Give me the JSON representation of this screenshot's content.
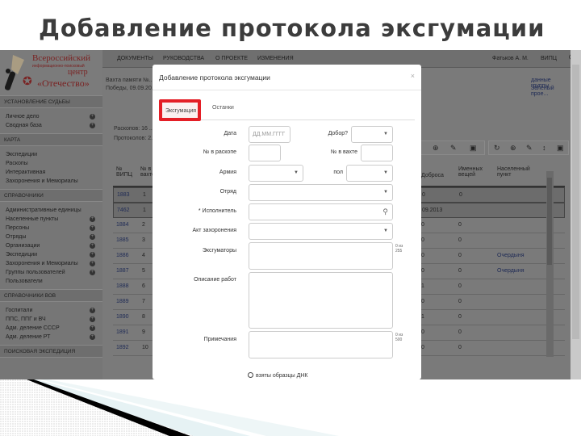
{
  "slide": {
    "title": "Добавление протокола эксгумации"
  },
  "logo": {
    "line1": "Всероссийский",
    "line2": "информационно-поисковый",
    "line3": "центр",
    "line4": "«Отечество»"
  },
  "topnav": {
    "items": [
      "Документы",
      "Руководства",
      "О проекте",
      "Изменения"
    ],
    "user": "Фатькoв А. М.",
    "org": "ВИПЦ",
    "power_icon": "power-icon"
  },
  "sidebar": {
    "sections": [
      {
        "title": "Установление судьбы",
        "items": [
          {
            "label": "Личное дело",
            "plus": true
          },
          {
            "label": "Сводная база",
            "plus": true
          }
        ]
      },
      {
        "title": "Карта",
        "items": [
          {
            "label": "Экспедиции",
            "plus": false
          },
          {
            "label": "Раскопы",
            "plus": false
          },
          {
            "label": "Интерактивная",
            "plus": false
          },
          {
            "label": "Захоронения и Мемориалы",
            "plus": false
          }
        ]
      },
      {
        "title": "Справочники",
        "items": [
          {
            "label": "Административные единицы",
            "plus": false
          },
          {
            "label": "Населенные пункты",
            "plus": true
          },
          {
            "label": "Персоны",
            "plus": true
          },
          {
            "label": "Отряды",
            "plus": true
          },
          {
            "label": "Организации",
            "plus": true
          },
          {
            "label": "Экспедиции",
            "plus": true
          },
          {
            "label": "Захоронения и Мемориалы",
            "plus": true
          },
          {
            "label": "Группы пользователей",
            "plus": true
          },
          {
            "label": "Пользователи",
            "plus": false
          }
        ]
      },
      {
        "title": "Справочники ВОВ",
        "items": [
          {
            "label": "Госпитали",
            "plus": true
          },
          {
            "label": "ППС, ППГ и ВЧ",
            "plus": true
          },
          {
            "label": "Адм. деление СССР",
            "plus": true
          },
          {
            "label": "Адм. деление РТ",
            "plus": true
          }
        ]
      },
      {
        "title": "Поисковая экспедиция",
        "items": []
      }
    ]
  },
  "background": {
    "header_line1": "Вахта памяти №...",
    "header_line2": "Победы, 09.09.20...",
    "right_line1": "данные группы",
    "right_line2": "Зеленый прое...",
    "stats_line1": "Раскопов: 16 ...",
    "stats_line2": "Протоколов: 2...",
    "columns": [
      "№ ВИПЦ",
      "№ в вахте",
      "Доброса",
      "Именных вещей",
      "Населенный пункт"
    ],
    "rows": [
      {
        "id": "1883",
        "n": "1",
        "d": "0",
        "v": "0",
        "place": "",
        "icon": "chevron-up-icon"
      },
      {
        "id": "7462",
        "n": "1",
        "d": "09.2013",
        "v": "",
        "place": "",
        "icon": ""
      },
      {
        "id": "1884",
        "n": "2",
        "d": "0",
        "v": "0",
        "place": "",
        "icon": "chevron-down-icon"
      },
      {
        "id": "1885",
        "n": "3",
        "d": "0",
        "v": "0",
        "place": "",
        "icon": "chevron-down-icon"
      },
      {
        "id": "1886",
        "n": "4",
        "d": "0",
        "v": "0",
        "place": "Очердыня",
        "icon": "chevron-down-icon"
      },
      {
        "id": "1887",
        "n": "5",
        "d": "0",
        "v": "0",
        "place": "Очердыня",
        "icon": "chevron-down-icon"
      },
      {
        "id": "1888",
        "n": "6",
        "d": "1",
        "v": "0",
        "place": "",
        "icon": "chevron-down-icon"
      },
      {
        "id": "1889",
        "n": "7",
        "d": "0",
        "v": "0",
        "place": "",
        "icon": "chevron-down-icon"
      },
      {
        "id": "1890",
        "n": "8",
        "d": "1",
        "v": "0",
        "place": "",
        "icon": "chevron-down-icon"
      },
      {
        "id": "1891",
        "n": "9",
        "d": "0",
        "v": "0",
        "place": "",
        "icon": "chevron-down-icon"
      },
      {
        "id": "1892",
        "n": "10",
        "d": "0",
        "v": "0",
        "place": "",
        "icon": "chevron-down-icon"
      }
    ]
  },
  "modal": {
    "title": "Добавление протокола эксгумации",
    "close": "×",
    "tabs": [
      {
        "label": "Эксгумация",
        "active": true,
        "highlighted": true
      },
      {
        "label": "Останки",
        "active": false
      }
    ],
    "fields": {
      "date_label": "Дата",
      "date_placeholder": "ДД.ММ.ГГГГ",
      "dobor_label": "Добор?",
      "dobor_value": "",
      "raskop_label": "№ в раскопе",
      "raskop_value": "",
      "vakhta_label": "№ в вахте",
      "vakhta_value": "",
      "army_label": "Армия",
      "army_value": "",
      "sex_label": "пол",
      "sex_value": "",
      "otryad_label": "Отряд",
      "otryad_value": "",
      "ispolnitel_label": "* Исполнитель",
      "ispolnitel_value": "",
      "akt_label": "Акт захоронения",
      "akt_value": "",
      "exhumators_label": "Эксгуматоры",
      "exhumators_counter": "0 из 255",
      "description_label": "Описание работ",
      "notes_label": "Примечания",
      "notes_counter": "0 из 500",
      "dna_label": "взяты образцы ДНК",
      "dna_checked": false
    }
  },
  "colors": {
    "highlight": "#e41e26",
    "overlay": "#7a7a7a",
    "link": "#1e2a55"
  }
}
